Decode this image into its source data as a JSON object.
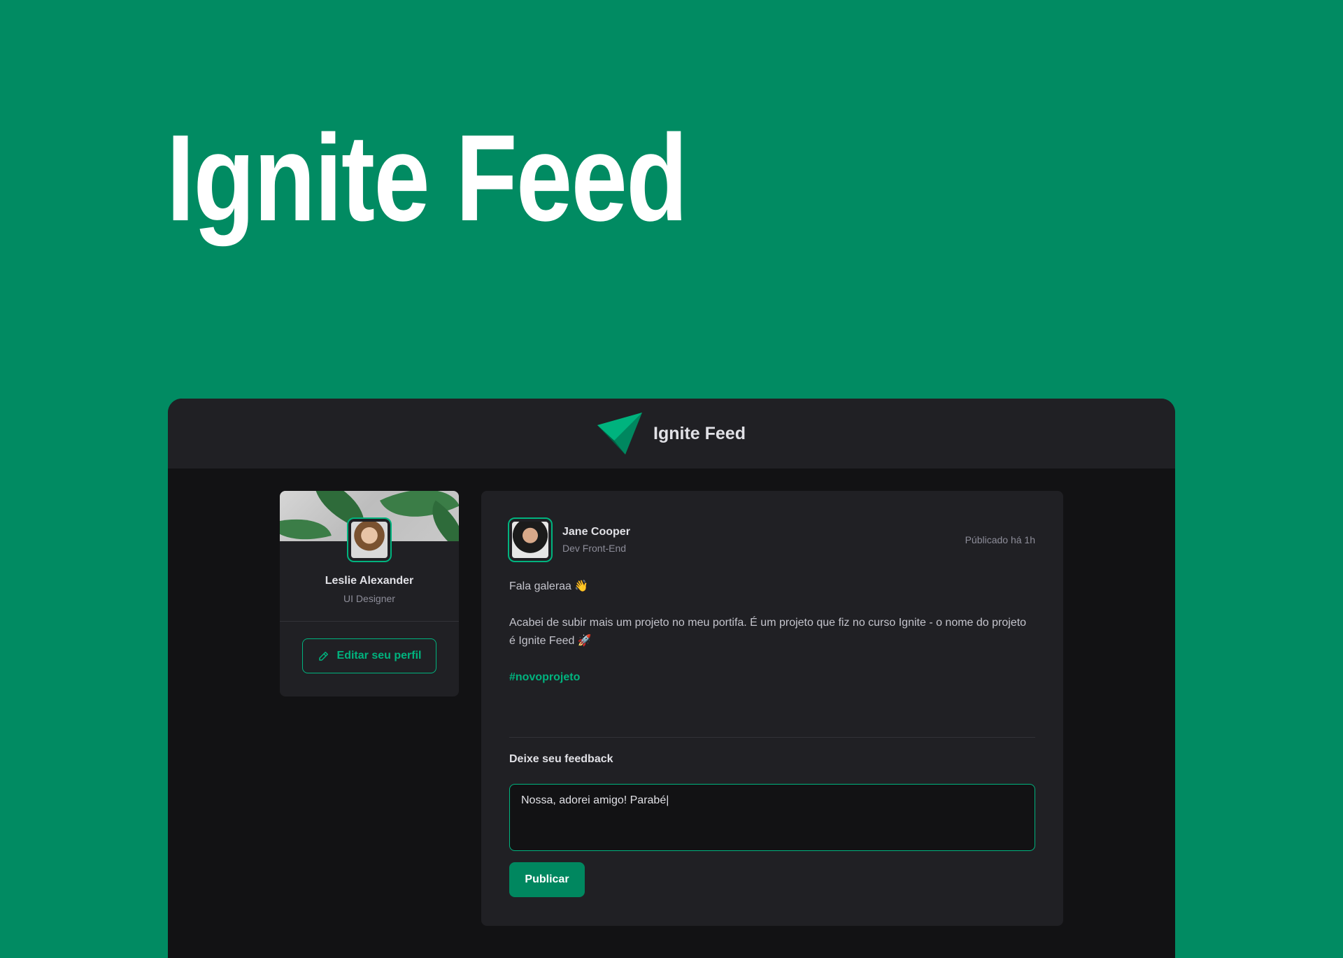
{
  "hero": {
    "title": "Ignite Feed"
  },
  "header": {
    "logo_icon": "ignite-logo-icon",
    "title": "Ignite Feed"
  },
  "sidebar": {
    "profile_name": "Leslie Alexander",
    "profile_role": "UI Designer",
    "edit_button_icon": "pencil-icon",
    "edit_button_label": "Editar seu perfil"
  },
  "post": {
    "author_name": "Jane Cooper",
    "author_role": "Dev Front-End",
    "published_at": "Públicado há 1h",
    "content": [
      "Fala galeraa 👋",
      "Acabei de subir mais um projeto no meu portifa. É um projeto que fiz no curso Ignite - o nome do projeto é Ignite Feed 🚀"
    ],
    "hashtag": "#novoprojeto"
  },
  "comment_form": {
    "title": "Deixe seu feedback",
    "value": "Nossa, adorei amigo! Parabé|",
    "submit_label": "Publicar"
  },
  "colors": {
    "brand_green": "#00b37e",
    "background_green": "#018b62",
    "app_background": "#121214",
    "card_background": "#202024"
  }
}
